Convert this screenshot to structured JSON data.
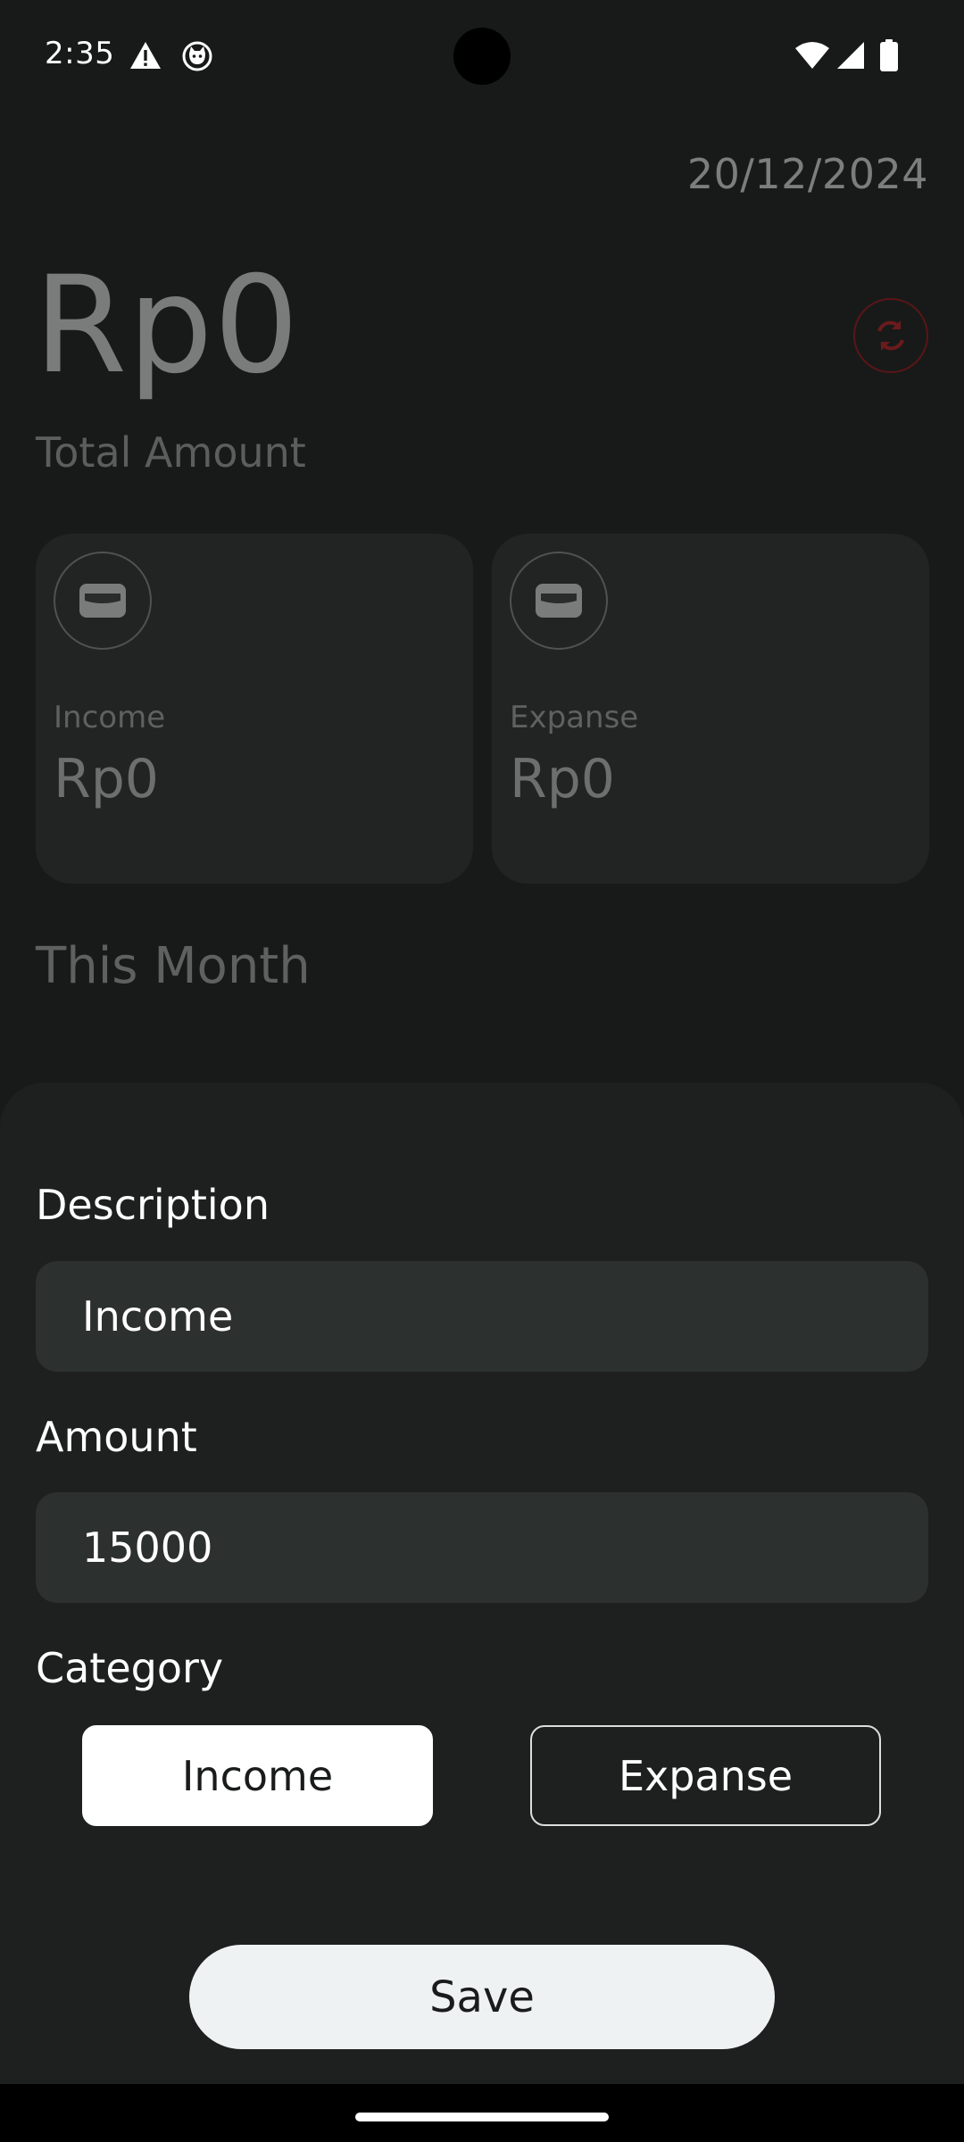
{
  "status_bar": {
    "time": "2:35",
    "icons": [
      "warning-icon",
      "cat-notification-icon",
      "wifi-icon",
      "signal-icon",
      "battery-icon"
    ]
  },
  "header": {
    "date": "20/12/2024",
    "total_amount": "Rp0",
    "total_label": "Total Amount",
    "refresh_icon": "refresh-icon"
  },
  "cards": {
    "income": {
      "label": "Income",
      "value": "Rp0",
      "icon": "wallet-icon"
    },
    "expanse": {
      "label": "Expanse",
      "value": "Rp0",
      "icon": "wallet-icon"
    }
  },
  "section": {
    "title": "This Month"
  },
  "form": {
    "description_label": "Description",
    "description_value": "Income",
    "amount_label": "Amount",
    "amount_value": "15000",
    "category_label": "Category",
    "categories": [
      {
        "label": "Income",
        "selected": true
      },
      {
        "label": "Expanse",
        "selected": false
      }
    ],
    "save_label": "Save"
  },
  "colors": {
    "background": "#181a19",
    "sheet": "#1d201f",
    "field": "#2c302e",
    "refresh_accent": "#5b1517",
    "save_button": "#eef2f3"
  }
}
